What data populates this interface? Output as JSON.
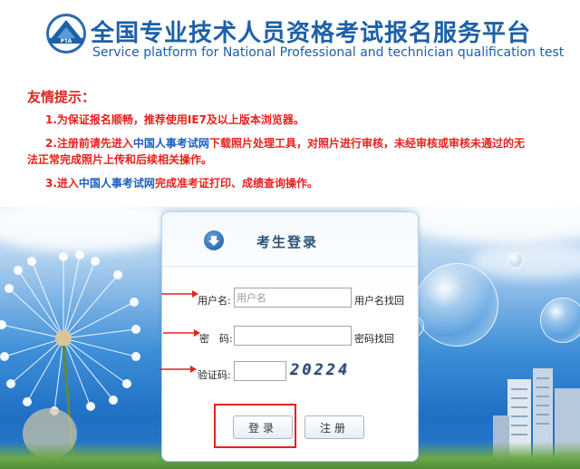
{
  "header": {
    "title_cn": "全国专业技术人员资格考试报名服务平台",
    "title_en": "Service platform for National Professional and technician qualification test",
    "logo_icon": "pta-logo"
  },
  "notice": {
    "heading": "友情提示：",
    "item1": "1.为保证报名顺畅，推荐使用IE7及以上版本浏览器。",
    "item2_prefix": "2.注册前请先进入",
    "item2_link": "中国人事考试网",
    "item2_suffix": "下载照片处理工具，对照片进行审核，未经审核或审核未通过的无",
    "item2_cont": "法正常完成照片上传和后续相关操作。",
    "item3_prefix": "3.进入",
    "item3_link": "中国人事考试网",
    "item3_suffix": "完成准考证打印、成绩查询操作。"
  },
  "login": {
    "title": "考生登录",
    "username_label": "用户名:",
    "username_placeholder": "用户名",
    "username_recover": "用户名找回",
    "password_label": "密　码:",
    "password_recover": "密码找回",
    "captcha_label": "验证码:",
    "captcha_text": "20224",
    "login_button": "登录",
    "register_button": "注册"
  },
  "colors": {
    "brand_blue": "#1d60a8",
    "notice_red": "#e8211d",
    "link_blue": "#1d5fc2",
    "highlight_red": "#e3241b"
  }
}
